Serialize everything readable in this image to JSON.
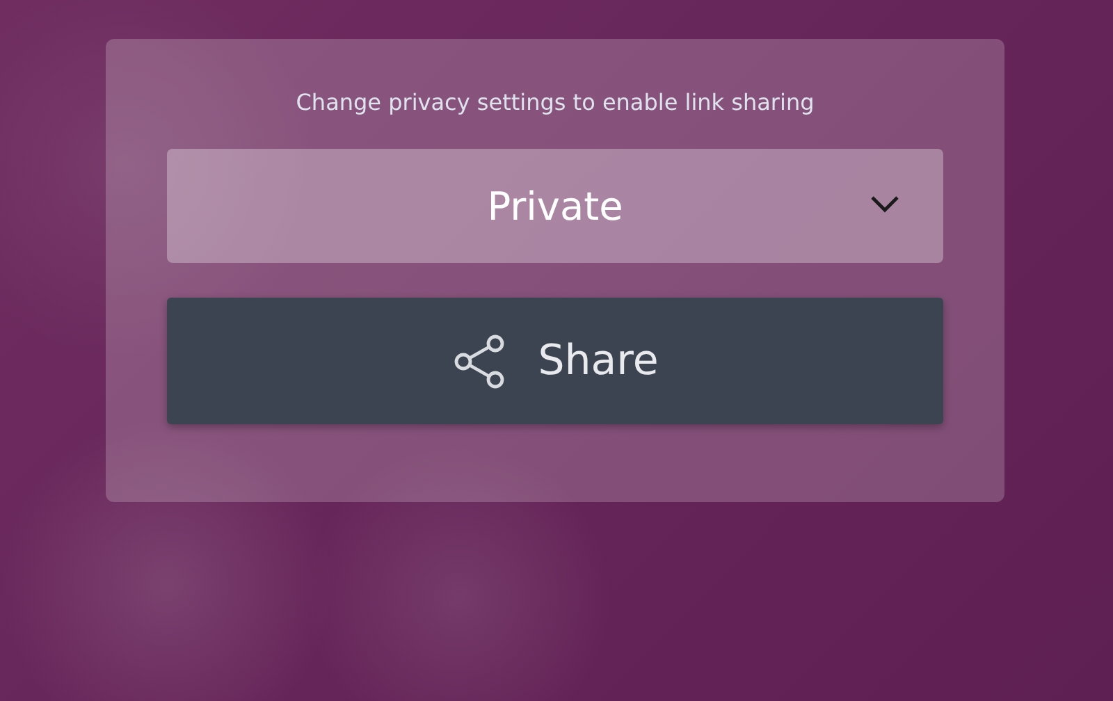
{
  "share_panel": {
    "message": "Change privacy settings to enable link sharing",
    "privacy_select": {
      "value": "Private"
    },
    "share_button": {
      "label": "Share"
    }
  }
}
